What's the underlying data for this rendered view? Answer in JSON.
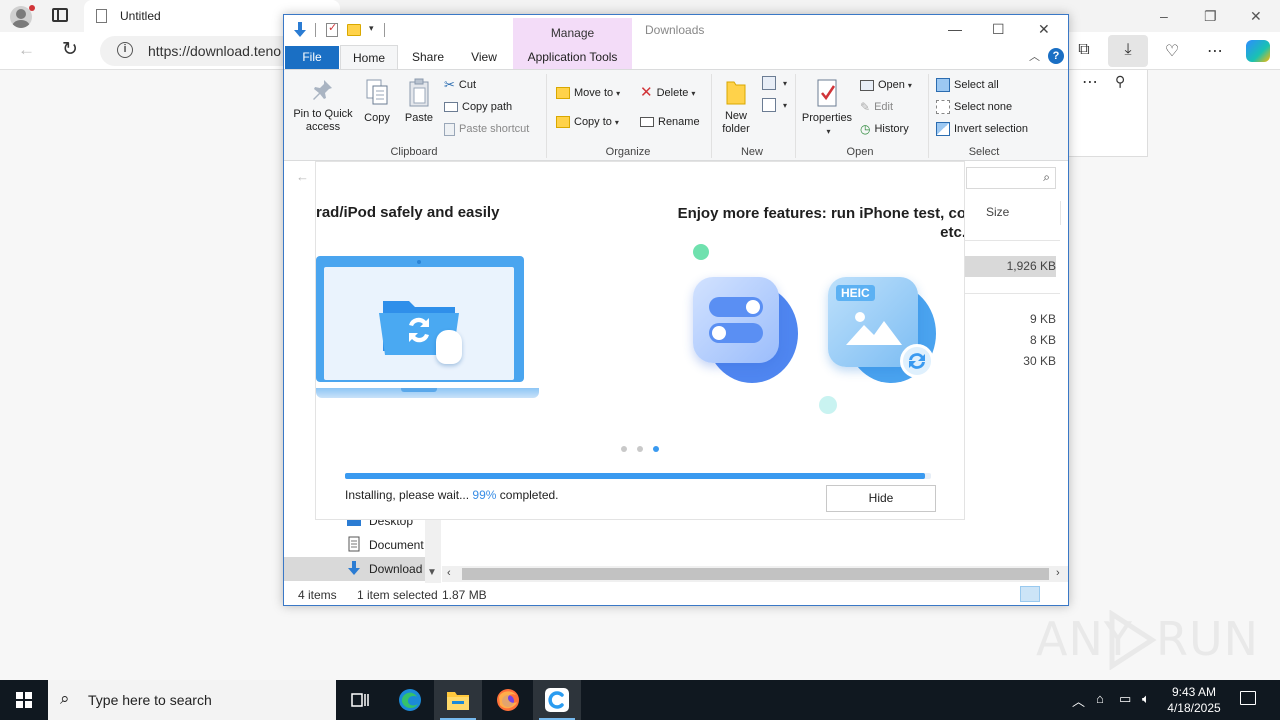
{
  "browser": {
    "tab_title": "Untitled",
    "url": "https://download.teno",
    "window_controls": [
      "–",
      "❐",
      "✕"
    ]
  },
  "explorer": {
    "title": "Downloads",
    "contextual_tab_group": "Manage",
    "tabs": [
      "File",
      "Home",
      "Share",
      "View",
      "Application Tools"
    ],
    "window_controls": [
      "—",
      "☐",
      "✕"
    ],
    "ribbon": {
      "clipboard": {
        "label": "Clipboard",
        "pin": "Pin to Quick access",
        "copy": "Copy",
        "paste": "Paste",
        "cut": "Cut",
        "copy_path": "Copy path",
        "paste_shortcut": "Paste shortcut"
      },
      "organize": {
        "label": "Organize",
        "move_to": "Move to",
        "copy_to": "Copy to",
        "delete": "Delete",
        "rename": "Rename"
      },
      "new": {
        "label": "New",
        "new_folder": "New folder"
      },
      "open": {
        "label": "Open",
        "properties": "Properties",
        "open": "Open",
        "edit": "Edit",
        "history": "History"
      },
      "select": {
        "label": "Select",
        "select_all": "Select all",
        "select_none": "Select none",
        "invert_selection": "Invert selection"
      }
    },
    "columns": {
      "size": "Size"
    },
    "file_sizes": [
      "1,926 KB",
      "9 KB",
      "8 KB",
      "30 KB"
    ],
    "nav_items": [
      "Desktop",
      "Document",
      "Download"
    ],
    "status": {
      "item_count": "4 items",
      "selection": "1 item selected",
      "selection_size": "1.87 MB"
    }
  },
  "installer": {
    "headline_left": "rad/iPod safely and easily",
    "headline_right_line1": "Enjoy more features: run iPhone test, co",
    "headline_right_line2": "etc.",
    "heic_label": "HEIC",
    "status_prefix": "Installing, please wait...",
    "progress_percent_text": "99%",
    "status_suffix": "completed.",
    "progress_value": 0.99,
    "hide_button": "Hide",
    "accent_color": "#3a9af0"
  },
  "taskbar": {
    "search_placeholder": "Type here to search",
    "time": "9:43 AM",
    "date": "4/18/2025"
  },
  "watermark": {
    "text_left": "ANY",
    "text_right": "RUN"
  }
}
